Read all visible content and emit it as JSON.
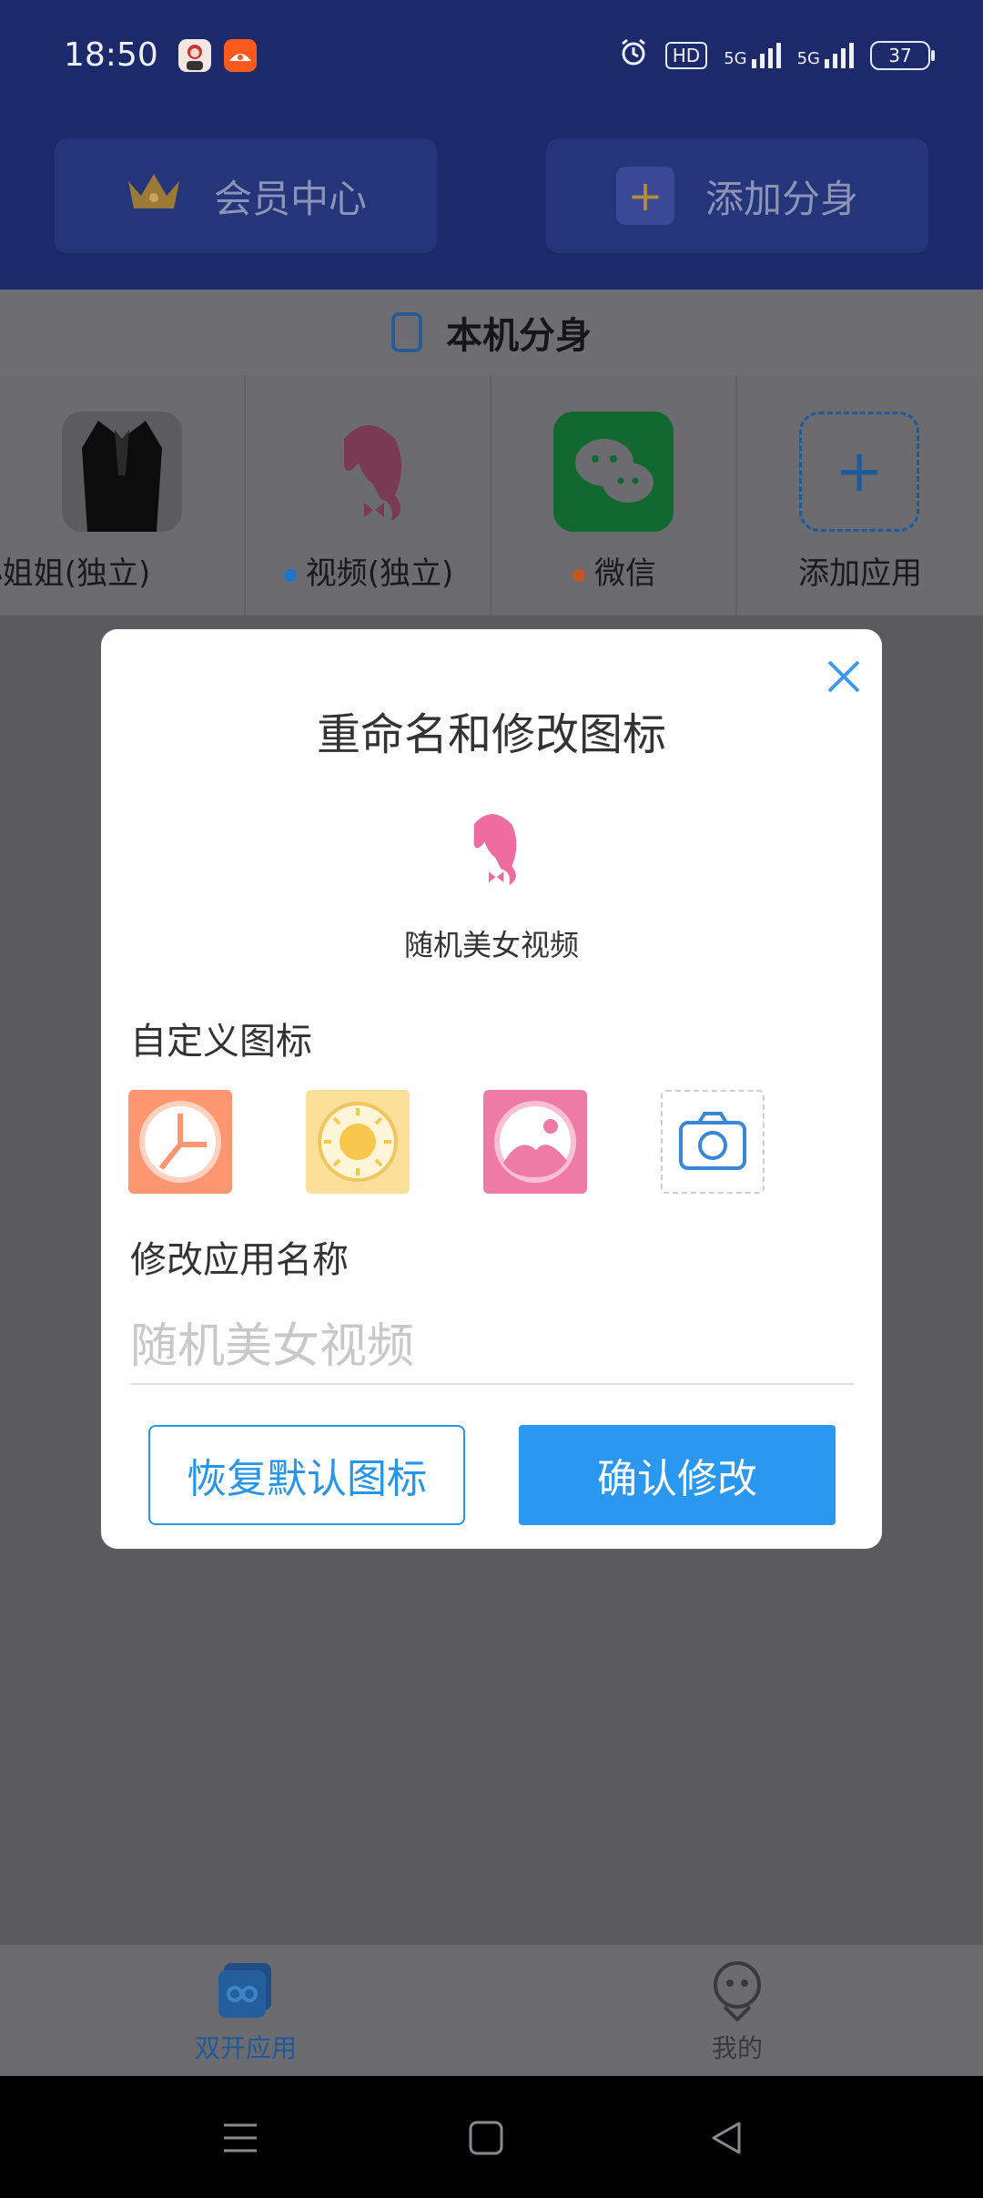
{
  "status_bar": {
    "time": "18:50",
    "hd_badge": "HD",
    "net1": "5G",
    "net2": "5G",
    "battery": "37"
  },
  "header": {
    "member_center": "会员中心",
    "add_clone": "添加分身"
  },
  "section": {
    "title": "本机分身"
  },
  "apps": [
    {
      "label": "小姐姐(独立)",
      "dot_color": ""
    },
    {
      "label": "视频(独立)",
      "dot_color": "#1f73c9"
    },
    {
      "label": "微信",
      "dot_color": "#c4561f"
    },
    {
      "label": "添加应用",
      "dot_color": ""
    }
  ],
  "dialog": {
    "title": "重命名和修改图标",
    "app_name": "随机美女视频",
    "custom_icon_label": "自定义图标",
    "rename_label": "修改应用名称",
    "name_placeholder": "随机美女视频",
    "restore_button": "恢复默认图标",
    "confirm_button": "确认修改",
    "icon_choices": [
      "clock-icon",
      "sun-icon",
      "gallery-icon",
      "camera-icon"
    ]
  },
  "tabs": {
    "dual_apps": "双开应用",
    "mine": "我的"
  },
  "colors": {
    "header_blue": "#1c2a6b",
    "accent_blue": "#2a98f0",
    "overlay": "#5a5a5f"
  }
}
